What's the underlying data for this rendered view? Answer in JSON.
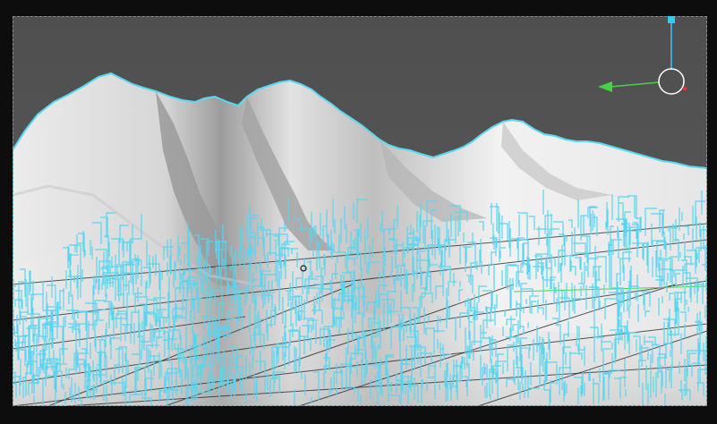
{
  "viewport": {
    "background": "#555555",
    "border_color": "#8a8a8a",
    "terrain_color": "#eeeeee",
    "terrain_shadow": "#a9a9a9",
    "selection_color": "#56d6f2",
    "grid_color": "#1e1e1e",
    "x_axis_color": "#3ddc3d"
  },
  "gizmo": {
    "up_axis_color": "#36c8f0",
    "right_axis_color": "#45d345",
    "ring_color": "#ffffff",
    "dot_color": "#e03030",
    "handle_icon": "axis-handle-icon",
    "rotate_icon": "rotation-ring-icon"
  },
  "pivot": {
    "icon": "pivot-circle-icon",
    "color": "#1a1a1a"
  }
}
